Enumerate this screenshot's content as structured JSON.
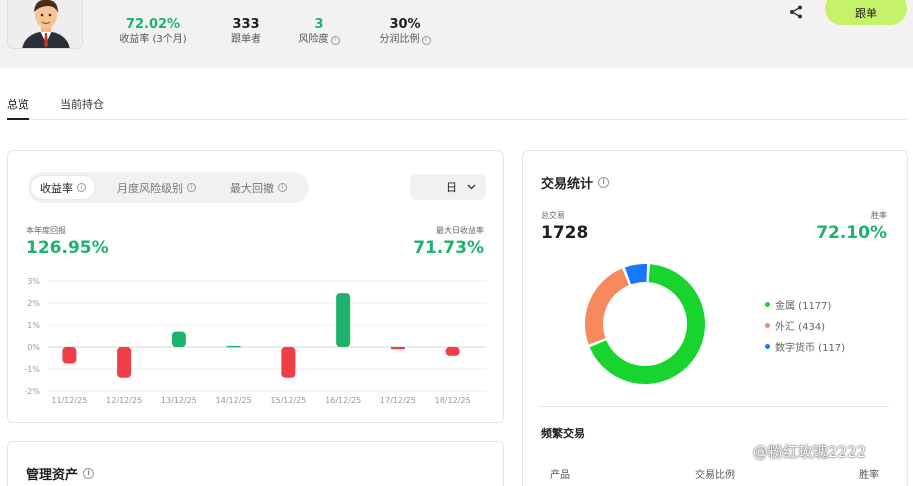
{
  "header": {
    "stats": [
      {
        "value": "72.02%",
        "label": "收益率 (3个月)",
        "info": false,
        "value_color": "#1db36b"
      },
      {
        "value": "333",
        "label": "跟单者",
        "info": false,
        "value_color": "#1f1f1f"
      },
      {
        "value": "3",
        "label": "风险度",
        "info": true,
        "value_color": "#1db36b"
      },
      {
        "value": "30%",
        "label": "分润比例",
        "info": true,
        "value_color": "#1f1f1f"
      }
    ],
    "share_icon": "share-icon",
    "follow_label": "跟单",
    "accent": "#c6f26a"
  },
  "tabs": [
    {
      "label": "总览",
      "active": true
    },
    {
      "label": "当前持仓",
      "active": false
    }
  ],
  "performance": {
    "segments": [
      {
        "label": "收益率",
        "active": true
      },
      {
        "label": "月度风险级别",
        "active": false
      },
      {
        "label": "最大回撤",
        "active": false
      }
    ],
    "period": "日",
    "left_metric": {
      "label": "本年度回报",
      "value": "126.95%"
    },
    "right_metric": {
      "label": "最大日收益率",
      "value": "71.73%"
    }
  },
  "chart_data": {
    "type": "bar",
    "categories": [
      "11/12/25",
      "12/12/25",
      "13/12/25",
      "14/12/25",
      "15/12/25",
      "16/12/25",
      "17/12/25",
      "18/12/25"
    ],
    "values": [
      -0.75,
      -1.4,
      0.7,
      0.05,
      -1.4,
      2.45,
      -0.1,
      -0.4
    ],
    "yticks": [
      "3%",
      "2%",
      "1%",
      "0%",
      "-1%",
      "-2%"
    ],
    "ylim": [
      -2,
      3
    ],
    "grid": true,
    "positive_color": "#1db36b",
    "negative_color": "#ef3e46"
  },
  "assets": {
    "title": "管理资产"
  },
  "trade_stats": {
    "title": "交易统计",
    "total_label": "总交易",
    "total_value": "1728",
    "win_label": "胜率",
    "win_value": "72.10%",
    "donut": [
      {
        "name": "金属 (1177)",
        "value": 1177,
        "color": "#18d42f"
      },
      {
        "name": "外汇 (434)",
        "value": 434,
        "color": "#f78a5c"
      },
      {
        "name": "数字货币 (117)",
        "value": 117,
        "color": "#1677ff"
      }
    ],
    "frequent_title": "频繁交易",
    "columns": [
      "产品",
      "交易比例",
      "胜率"
    ]
  },
  "watermark": "@粉红玫瑰2222"
}
